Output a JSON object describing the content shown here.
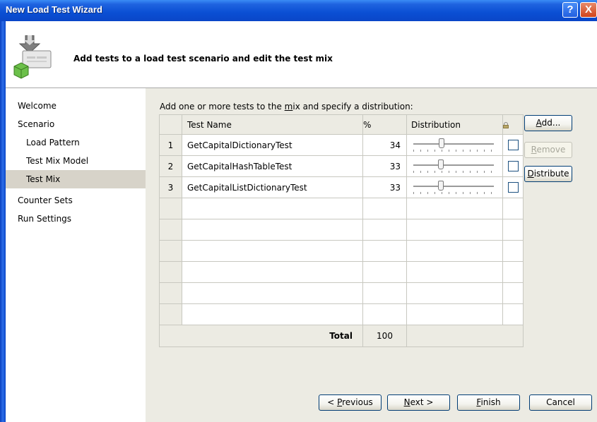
{
  "window": {
    "title": "New Load Test Wizard",
    "help_glyph": "?",
    "close_glyph": "X"
  },
  "header": {
    "text": "Add tests to a load test scenario and edit the test mix"
  },
  "nav": {
    "items": [
      {
        "label": "Welcome",
        "level": 0,
        "selected": false
      },
      {
        "label": "Scenario",
        "level": 0,
        "selected": false
      },
      {
        "label": "Load Pattern",
        "level": 1,
        "selected": false
      },
      {
        "label": "Test Mix Model",
        "level": 1,
        "selected": false
      },
      {
        "label": "Test Mix",
        "level": 1,
        "selected": true
      },
      {
        "label": "Counter Sets",
        "level": 0,
        "selected": false
      },
      {
        "label": "Run Settings",
        "level": 0,
        "selected": false
      }
    ]
  },
  "main": {
    "instruction": {
      "pre": "Add one or more tests to the ",
      "mnemonic": "m",
      "post": "ix and specify a distribution:"
    },
    "columns": {
      "name": "Test Name",
      "pct": "%",
      "dist": "Distribution",
      "lock_icon": "lock-icon"
    },
    "rows": [
      {
        "index": "1",
        "name": "GetCapitalDictionaryTest",
        "pct": "34",
        "dist_fraction": 0.34
      },
      {
        "index": "2",
        "name": "GetCapitalHashTableTest",
        "pct": "33",
        "dist_fraction": 0.33
      },
      {
        "index": "3",
        "name": "GetCapitalListDictionaryTest",
        "pct": "33",
        "dist_fraction": 0.33
      }
    ],
    "total_label": "Total",
    "total_value": "100",
    "buttons": {
      "add": {
        "mnemonic": "A",
        "rest": "dd..."
      },
      "remove": {
        "mnemonic": "R",
        "rest": "emove"
      },
      "distribute": {
        "mnemonic": "D",
        "rest": "istribute"
      }
    }
  },
  "footer": {
    "previous": {
      "pre": "< ",
      "mnemonic": "P",
      "rest": "revious"
    },
    "next": {
      "mnemonic": "N",
      "rest": "ext >"
    },
    "finish": {
      "mnemonic": "F",
      "rest": "inish"
    },
    "cancel": "Cancel"
  }
}
